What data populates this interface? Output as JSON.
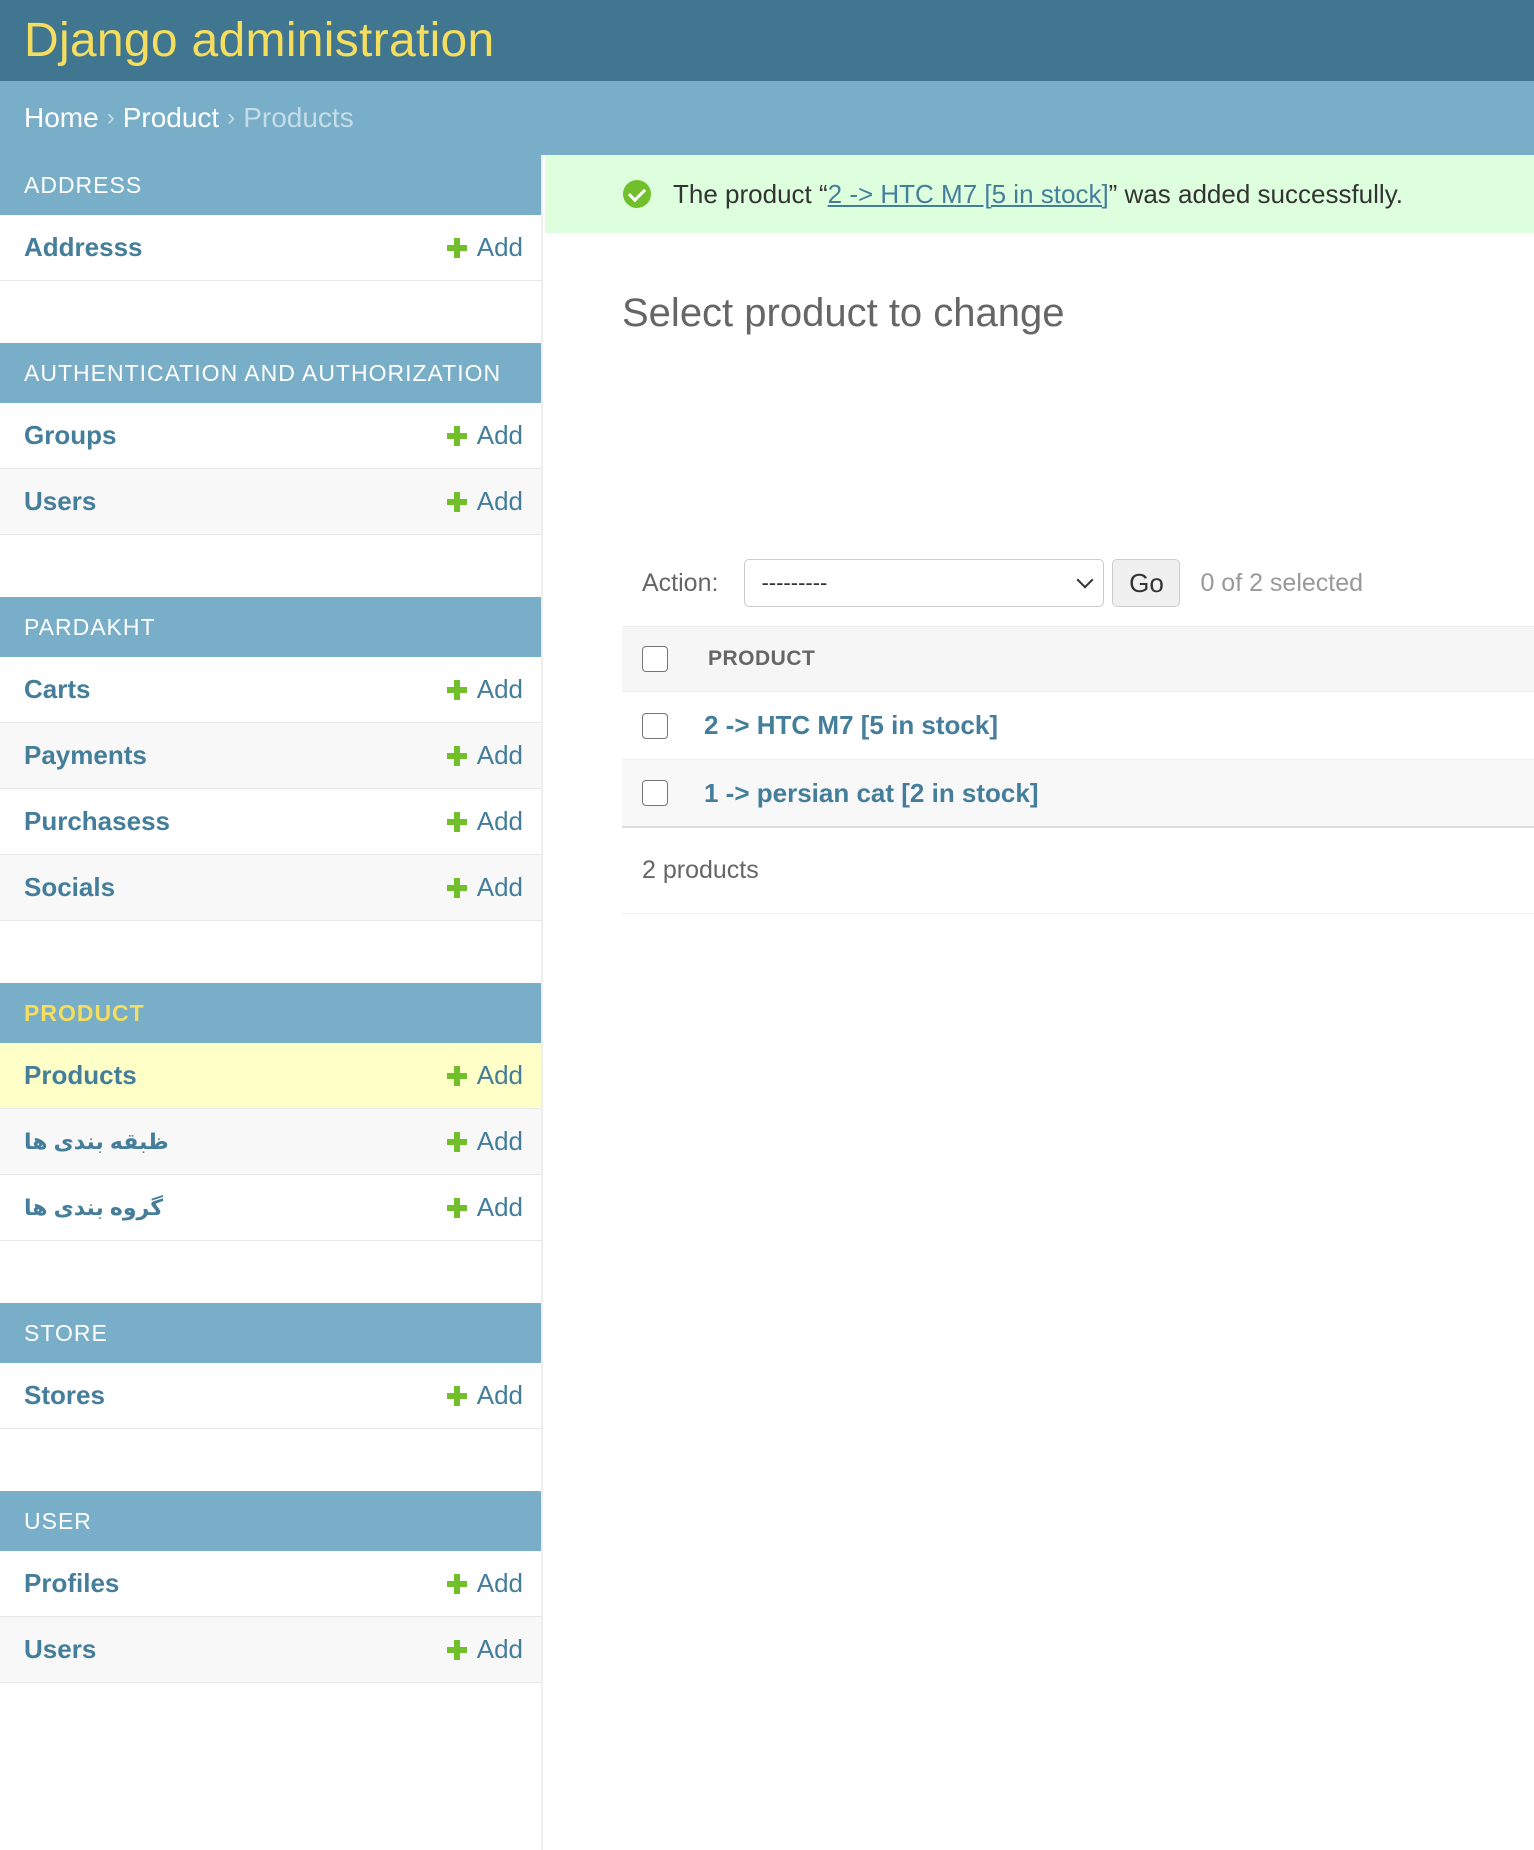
{
  "header": {
    "brand": "Django administration"
  },
  "breadcrumbs": {
    "home": "Home",
    "section": "Product",
    "current": "Products",
    "separator": "›"
  },
  "sidebar": {
    "add_label": "Add",
    "modules": [
      {
        "caption": "Address",
        "models": [
          "Addresss"
        ]
      },
      {
        "caption": "Authentication and Authorization",
        "models": [
          "Groups",
          "Users"
        ]
      },
      {
        "caption": "Pardakht",
        "models": [
          "Carts",
          "Payments",
          "Purchasess",
          "Socials"
        ]
      },
      {
        "caption": "Product",
        "models": [
          "Products",
          "ظبقه بندی ها",
          "گروه بندی ها"
        ]
      },
      {
        "caption": "Store",
        "models": [
          "Stores"
        ]
      },
      {
        "caption": "User",
        "models": [
          "Profiles",
          "Users"
        ]
      }
    ]
  },
  "message": {
    "prefix": "The product “",
    "link": "2 -> HTC M7 [5 in stock]",
    "suffix": "” was added successfully."
  },
  "content": {
    "title": "Select product to change",
    "action_label": "Action:",
    "action_selected": "---------",
    "go_label": "Go",
    "counter": "0 of 2 selected",
    "column_header": "PRODUCT",
    "rows": [
      "2 -> HTC M7 [5 in stock]",
      "1 -> persian cat [2 in stock]"
    ],
    "paginator": "2 products"
  }
}
